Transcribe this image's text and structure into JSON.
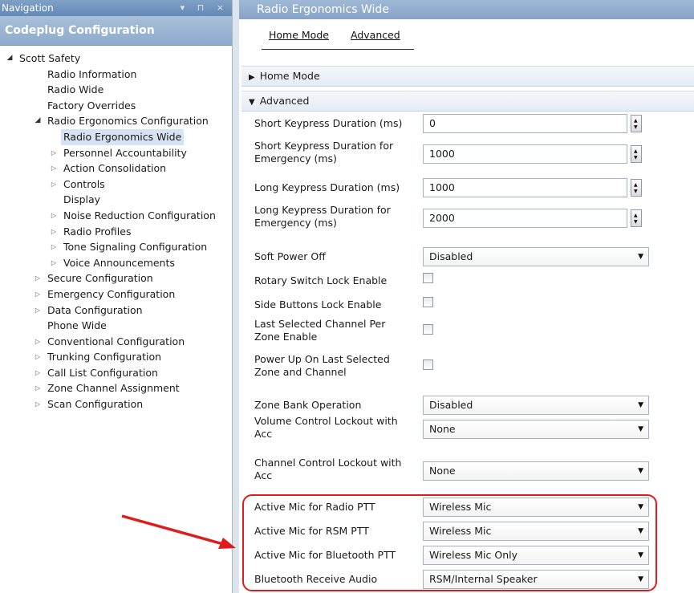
{
  "nav": {
    "panel_title": "Navigation",
    "panel_buttons": "▾ ⊓ ×",
    "header": "Codeplug Configuration",
    "tree": [
      {
        "label": "Scott Safety",
        "level": 0,
        "arrow": "open"
      },
      {
        "label": "Radio Information",
        "level": 1,
        "arrow": ""
      },
      {
        "label": "Radio Wide",
        "level": 1,
        "arrow": ""
      },
      {
        "label": "Factory Overrides",
        "level": 1,
        "arrow": ""
      },
      {
        "label": "Radio Ergonomics Configuration",
        "level": 1,
        "arrow": "open"
      },
      {
        "label": "Radio Ergonomics Wide",
        "level": 2,
        "arrow": "",
        "selected": true
      },
      {
        "label": "Personnel Accountability",
        "level": 2,
        "arrow": "closed"
      },
      {
        "label": "Action Consolidation",
        "level": 2,
        "arrow": "closed"
      },
      {
        "label": "Controls",
        "level": 2,
        "arrow": "closed"
      },
      {
        "label": "Display",
        "level": 2,
        "arrow": ""
      },
      {
        "label": "Noise Reduction Configuration",
        "level": 2,
        "arrow": "closed"
      },
      {
        "label": "Radio Profiles",
        "level": 2,
        "arrow": "closed"
      },
      {
        "label": "Tone Signaling Configuration",
        "level": 2,
        "arrow": "closed"
      },
      {
        "label": "Voice Announcements",
        "level": 2,
        "arrow": "closed"
      },
      {
        "label": "Secure Configuration",
        "level": 1,
        "arrow": "closed"
      },
      {
        "label": "Emergency Configuration",
        "level": 1,
        "arrow": "closed"
      },
      {
        "label": "Data Configuration",
        "level": 1,
        "arrow": "closed"
      },
      {
        "label": "Phone Wide",
        "level": 1,
        "arrow": ""
      },
      {
        "label": "Conventional Configuration",
        "level": 1,
        "arrow": "closed"
      },
      {
        "label": "Trunking Configuration",
        "level": 1,
        "arrow": "closed"
      },
      {
        "label": "Call List Configuration",
        "level": 1,
        "arrow": "closed"
      },
      {
        "label": "Zone Channel Assignment",
        "level": 1,
        "arrow": "closed"
      },
      {
        "label": "Scan Configuration",
        "level": 1,
        "arrow": "closed"
      }
    ]
  },
  "main": {
    "title": "Radio Ergonomics Wide",
    "tabs": [
      "Home Mode",
      "Advanced"
    ],
    "sections": {
      "home_mode": "Home Mode",
      "advanced": "Advanced"
    },
    "fields": [
      {
        "label": "Short Keypress Duration (ms)",
        "type": "spin",
        "value": "0"
      },
      {
        "label": "Short Keypress Duration for Emergency (ms)",
        "type": "spin",
        "value": "1000"
      },
      {
        "label": "Long Keypress Duration (ms)",
        "type": "spin",
        "value": "1000"
      },
      {
        "label": "Long Keypress Duration for Emergency (ms)",
        "type": "spin",
        "value": "2000"
      },
      {
        "label": "Soft Power Off",
        "type": "combo",
        "value": "Disabled"
      },
      {
        "label": "Rotary Switch Lock Enable",
        "type": "check",
        "value": ""
      },
      {
        "label": "Side Buttons Lock Enable",
        "type": "check",
        "value": ""
      },
      {
        "label": "Last Selected Channel Per Zone Enable",
        "type": "check",
        "value": ""
      },
      {
        "label": "Power Up On Last Selected Zone and Channel",
        "type": "check",
        "value": ""
      },
      {
        "label": "Zone Bank Operation",
        "type": "combo",
        "value": "Disabled"
      },
      {
        "label": "Volume Control Lockout with Acc",
        "type": "combo",
        "value": "None"
      },
      {
        "label": "Channel Control Lockout with Acc",
        "type": "combo",
        "value": "None"
      },
      {
        "label": "Active Mic for Radio PTT",
        "type": "combo",
        "value": "Wireless Mic"
      },
      {
        "label": "Active Mic for RSM PTT",
        "type": "combo",
        "value": "Wireless Mic"
      },
      {
        "label": "Active Mic for Bluetooth PTT",
        "type": "combo",
        "value": "Wireless Mic Only"
      },
      {
        "label": "Bluetooth Receive Audio",
        "type": "combo",
        "value": "RSM/Internal Speaker"
      }
    ]
  },
  "colors": {
    "highlight_box": "#e01b1b",
    "arrow": "#e01b1b",
    "selection": "#d6e3f2",
    "title_bar": "#86a3c7"
  }
}
